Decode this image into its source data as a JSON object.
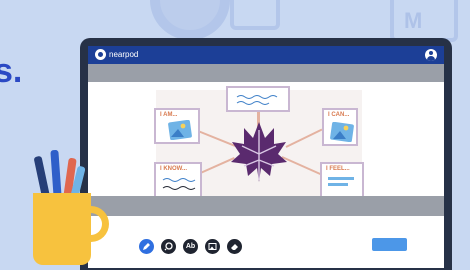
{
  "app": {
    "brand": "nearpod"
  },
  "background": {
    "letter_left": "S",
    "letter_right": "M",
    "letter_cut": "s."
  },
  "slide": {
    "cards": [
      {
        "id": "top-left",
        "label": "I AM..."
      },
      {
        "id": "top-center",
        "label": ""
      },
      {
        "id": "top-right",
        "label": "I CAN..."
      },
      {
        "id": "bottom-left",
        "label": "I KNOW..."
      },
      {
        "id": "bottom-right",
        "label": "I FEEL..."
      }
    ]
  },
  "toolbar": {
    "tools": [
      {
        "name": "pen",
        "icon": "pencil-icon"
      },
      {
        "name": "highlighter",
        "icon": "marker-icon"
      },
      {
        "name": "text",
        "icon": "text-icon",
        "glyph": "Ab"
      },
      {
        "name": "image",
        "icon": "image-icon"
      },
      {
        "name": "eraser",
        "icon": "eraser-icon"
      }
    ],
    "submit_label": ""
  },
  "colors": {
    "app_bar": "#1c3f97",
    "laptop_bezel": "#263147",
    "leaf": "#5a2a6e",
    "accent_tool": "#2f6fe0",
    "submit": "#4c97e8",
    "mug": "#f7c23e"
  }
}
